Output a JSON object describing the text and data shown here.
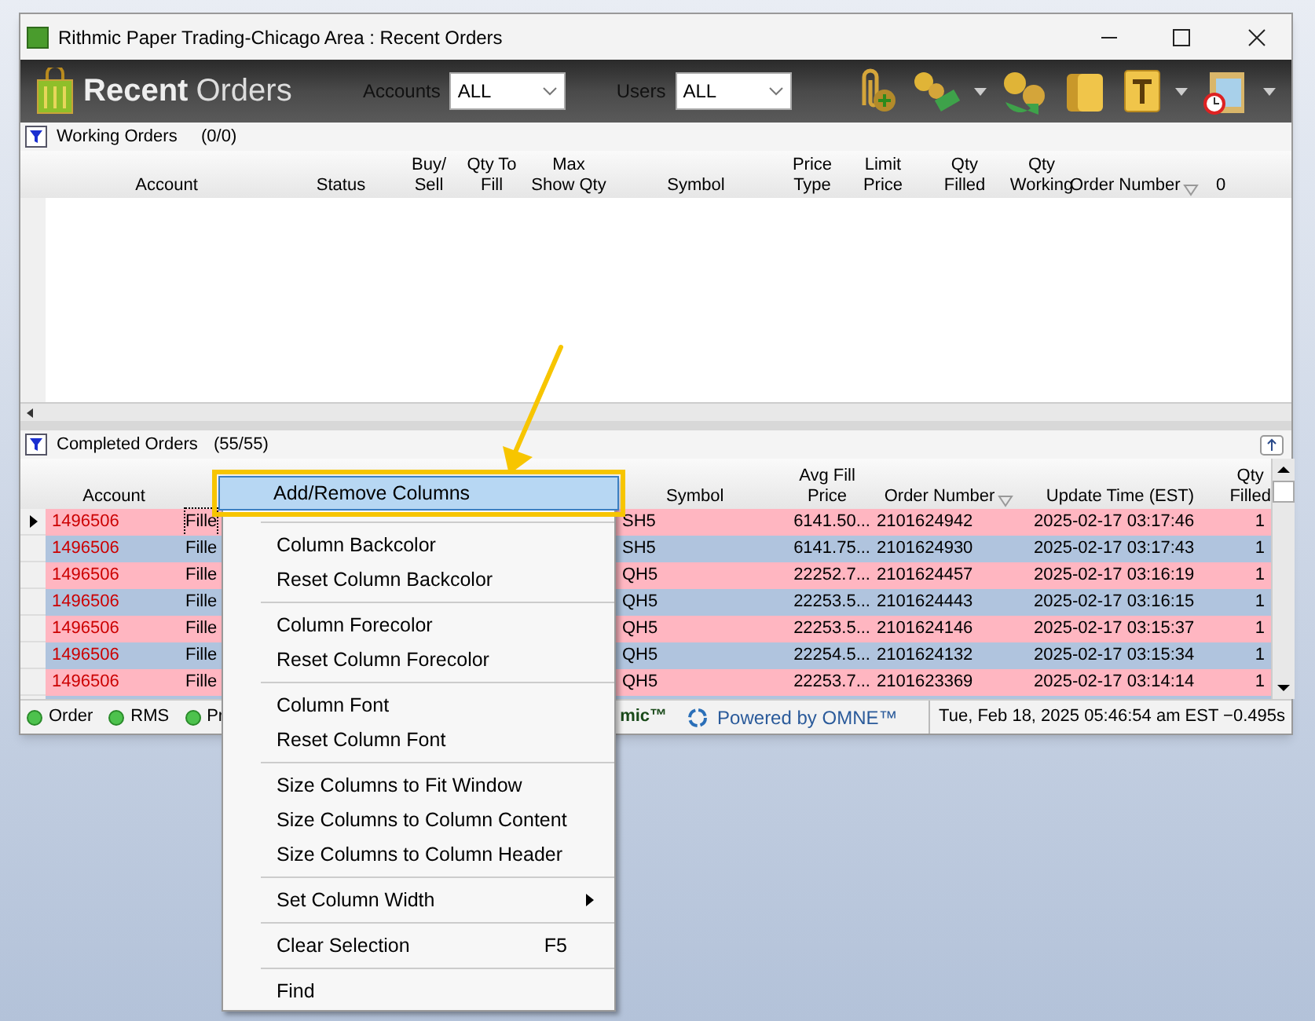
{
  "window": {
    "title": "Rithmic Paper Trading-Chicago Area : Recent Orders"
  },
  "toolbar": {
    "title_bold": "Recent",
    "title_light": "Orders",
    "accounts_label": "Accounts",
    "accounts_value": "ALL",
    "users_label": "Users",
    "users_value": "ALL"
  },
  "working_orders": {
    "title": "Working Orders",
    "count": "(0/0)",
    "columns": [
      "Account",
      "Status",
      "Buy/\nSell",
      "Qty To\nFill",
      "Max\nShow Qty",
      "Symbol",
      "Price\nType",
      "Limit\nPrice",
      "Qty\nFilled",
      "Qty\nWorking",
      "Order Number",
      "0"
    ]
  },
  "completed_orders": {
    "title": "Completed Orders",
    "count": "(55/55)",
    "columns": [
      "Account",
      "",
      "Symbol",
      "Avg Fill\nPrice",
      "Order Number",
      "Update Time (EST)",
      "Qty\nFilled"
    ],
    "rows": [
      {
        "selected": true,
        "color": "#ffb6c1",
        "cells": [
          "1496506",
          "Fille",
          "SH5",
          "6141.50...",
          "2101624942",
          "2025-02-17 03:17:46",
          "1"
        ]
      },
      {
        "selected": false,
        "color": "#b0c4de",
        "cells": [
          "1496506",
          "Fille",
          "SH5",
          "6141.75...",
          "2101624930",
          "2025-02-17 03:17:43",
          "1"
        ]
      },
      {
        "selected": false,
        "color": "#ffb6c1",
        "cells": [
          "1496506",
          "Fille",
          "QH5",
          "22252.7...",
          "2101624457",
          "2025-02-17 03:16:19",
          "1"
        ]
      },
      {
        "selected": false,
        "color": "#b0c4de",
        "cells": [
          "1496506",
          "Fille",
          "QH5",
          "22253.5...",
          "2101624443",
          "2025-02-17 03:16:15",
          "1"
        ]
      },
      {
        "selected": false,
        "color": "#ffb6c1",
        "cells": [
          "1496506",
          "Fille",
          "QH5",
          "22253.5...",
          "2101624146",
          "2025-02-17 03:15:37",
          "1"
        ]
      },
      {
        "selected": false,
        "color": "#b0c4de",
        "cells": [
          "1496506",
          "Fille",
          "QH5",
          "22254.5...",
          "2101624132",
          "2025-02-17 03:15:34",
          "1"
        ]
      },
      {
        "selected": false,
        "color": "#ffb6c1",
        "cells": [
          "1496506",
          "Fille",
          "QH5",
          "22253.7...",
          "2101623369",
          "2025-02-17 03:14:14",
          "1"
        ]
      }
    ]
  },
  "status_bar": {
    "indicators": [
      "Order",
      "RMS",
      "Pr"
    ],
    "brand_fragment": "mic™",
    "powered": "Powered by OMNE™",
    "clock": "Tue, Feb 18, 2025 05:46:54 am EST −0.495s"
  },
  "context_menu": {
    "groups": [
      [
        {
          "label": "Add/Remove Columns",
          "selected": true,
          "submenu": false
        }
      ],
      [
        {
          "label": "Column Backcolor",
          "selected": false,
          "submenu": false
        },
        {
          "label": "Reset Column Backcolor",
          "selected": false,
          "submenu": false
        }
      ],
      [
        {
          "label": "Column Forecolor",
          "selected": false,
          "submenu": false
        },
        {
          "label": "Reset Column Forecolor",
          "selected": false,
          "submenu": false
        }
      ],
      [
        {
          "label": "Column Font",
          "selected": false,
          "submenu": false
        },
        {
          "label": "Reset Column Font",
          "selected": false,
          "submenu": false
        }
      ],
      [
        {
          "label": "Size Columns to Fit Window",
          "selected": false,
          "submenu": false
        },
        {
          "label": "Size Columns to Column Content",
          "selected": false,
          "submenu": false
        },
        {
          "label": "Size Columns to Column Header",
          "selected": false,
          "submenu": false
        }
      ],
      [
        {
          "label": "Set Column Width",
          "selected": false,
          "submenu": true
        }
      ],
      [
        {
          "label": "Clear Selection",
          "shortcut": "F5",
          "selected": false,
          "submenu": false
        }
      ],
      [
        {
          "label": "Find",
          "selected": false,
          "submenu": false
        }
      ]
    ]
  }
}
